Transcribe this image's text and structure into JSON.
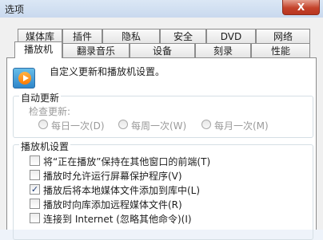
{
  "window": {
    "title": "选项",
    "close_glyph": "X"
  },
  "tabs_row1": [
    "媒体库",
    "插件",
    "隐私",
    "安全",
    "DVD",
    "网络"
  ],
  "tabs_row2": [
    "播放机",
    "翻录音乐",
    "设备",
    "刻录",
    "性能"
  ],
  "active_tab": "播放机",
  "header": {
    "description": "自定义更新和播放机设置。"
  },
  "auto_update": {
    "legend": "自动更新",
    "check_label": "检查更新:",
    "options": [
      "每日一次(D)",
      "每周一次(W)",
      "每月一次(M)"
    ]
  },
  "player_settings": {
    "legend": "播放机设置",
    "items": [
      {
        "label": "将“正在播放”保持在其他窗口的前端(T)",
        "checked": false
      },
      {
        "label": "播放时允许运行屏幕保护程序(V)",
        "checked": false
      },
      {
        "label": "播放后将本地媒体文件添加到库中(L)",
        "checked": true
      },
      {
        "label": "播放时向库添加远程媒体文件(R)",
        "checked": false
      },
      {
        "label": "连接到 Internet (忽略其他命令)(I)",
        "checked": false
      }
    ]
  }
}
